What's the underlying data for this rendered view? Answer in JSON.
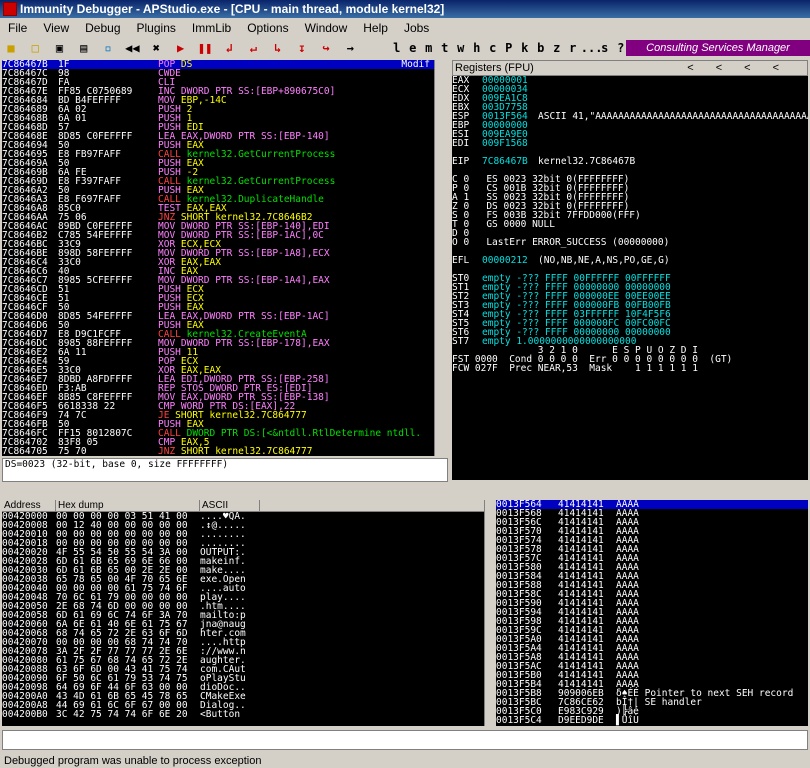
{
  "window": {
    "title": "Immunity Debugger - APStudio.exe - [CPU - main thread, module kernel32]"
  },
  "menu": [
    "File",
    "View",
    "Debug",
    "Plugins",
    "ImmLib",
    "Options",
    "Window",
    "Help",
    "Jobs"
  ],
  "toolbar": {
    "icons": [
      "open-icon",
      "folder-icon",
      "restart-icon",
      "close-icon",
      "attach-icon"
    ],
    "run_icons": [
      "rewind",
      "stop",
      "play",
      "pause",
      "step-into",
      "step-over",
      "trace-into",
      "trace-over",
      "return",
      "goto"
    ],
    "letters": [
      "l",
      "e",
      "m",
      "t",
      "w",
      "h",
      "c",
      "P",
      "k",
      "b",
      "z",
      "r",
      "...",
      "s",
      "?"
    ],
    "consulting": "Consulting Services Manager"
  },
  "cpu": {
    "rows": [
      {
        "addr": "7C86467B",
        "hex": "1F",
        "asm": "POP DS",
        "cls": "",
        "sel": true,
        "comment": "Modif"
      },
      {
        "addr": "7C86467C",
        "hex": "98",
        "asm": "CWDE",
        "cls": ""
      },
      {
        "addr": "7C86467D",
        "hex": "FA",
        "asm": "CLI",
        "cls": ""
      },
      {
        "addr": "7C86467E",
        "hex": "FF85 C0750689",
        "asm": "INC DWORD PTR SS:[EBP+890675C0]",
        "cls": ""
      },
      {
        "addr": "7C864684",
        "hex": "BD B4FEFFFF",
        "asm": "MOV EBP,-14C",
        "cls": ""
      },
      {
        "addr": "7C864689",
        "hex": "6A 02",
        "asm": "PUSH 2",
        "cls": ""
      },
      {
        "addr": "7C86468B",
        "hex": "6A 01",
        "asm": "PUSH 1",
        "cls": ""
      },
      {
        "addr": "7C86468D",
        "hex": "57",
        "asm": "PUSH EDI",
        "cls": ""
      },
      {
        "addr": "7C86468E",
        "hex": "8D85 C0FEFFFF",
        "asm": "LEA EAX,DWORD PTR SS:[EBP-140]",
        "cls": ""
      },
      {
        "addr": "7C864694",
        "hex": "50",
        "asm": "PUSH EAX",
        "cls": ""
      },
      {
        "addr": "7C864695",
        "hex": "E8 FB97FAFF",
        "asm": "CALL kernel32.GetCurrentProcess",
        "cls": "call"
      },
      {
        "addr": "7C86469A",
        "hex": "50",
        "asm": "PUSH EAX",
        "cls": ""
      },
      {
        "addr": "7C86469B",
        "hex": "6A FE",
        "asm": "PUSH -2",
        "cls": ""
      },
      {
        "addr": "7C86469D",
        "hex": "E8 F397FAFF",
        "asm": "CALL kernel32.GetCurrentProcess",
        "cls": "call"
      },
      {
        "addr": "7C8646A2",
        "hex": "50",
        "asm": "PUSH EAX",
        "cls": ""
      },
      {
        "addr": "7C8646A3",
        "hex": "E8 F697FAFF",
        "asm": "CALL kernel32.DuplicateHandle",
        "cls": "call"
      },
      {
        "addr": "7C8646A8",
        "hex": "85C0",
        "asm": "TEST EAX,EAX",
        "cls": ""
      },
      {
        "addr": "7C8646AA",
        "hex": "75 06",
        "asm": "JNZ SHORT kernel32.7C8646B2",
        "cls": "jmp"
      },
      {
        "addr": "7C8646AC",
        "hex": "89BD C0FEFFFF",
        "asm": "MOV DWORD PTR SS:[EBP-140],EDI",
        "cls": ""
      },
      {
        "addr": "7C8646B2",
        "hex": "C785 54FEFFFF",
        "asm": "MOV DWORD PTR SS:[EBP-1AC],0C",
        "cls": ""
      },
      {
        "addr": "7C8646BC",
        "hex": "33C9",
        "asm": "XOR ECX,ECX",
        "cls": ""
      },
      {
        "addr": "7C8646BE",
        "hex": "898D 58FEFFFF",
        "asm": "MOV DWORD PTR SS:[EBP-1A8],ECX",
        "cls": ""
      },
      {
        "addr": "7C8646C4",
        "hex": "33C0",
        "asm": "XOR EAX,EAX",
        "cls": ""
      },
      {
        "addr": "7C8646C6",
        "hex": "40",
        "asm": "INC EAX",
        "cls": ""
      },
      {
        "addr": "7C8646C7",
        "hex": "8985 5CFEFFFF",
        "asm": "MOV DWORD PTR SS:[EBP-1A4],EAX",
        "cls": ""
      },
      {
        "addr": "7C8646CD",
        "hex": "51",
        "asm": "PUSH ECX",
        "cls": ""
      },
      {
        "addr": "7C8646CE",
        "hex": "51",
        "asm": "PUSH ECX",
        "cls": ""
      },
      {
        "addr": "7C8646CF",
        "hex": "50",
        "asm": "PUSH EAX",
        "cls": ""
      },
      {
        "addr": "7C8646D0",
        "hex": "8D85 54FEFFFF",
        "asm": "LEA EAX,DWORD PTR SS:[EBP-1AC]",
        "cls": ""
      },
      {
        "addr": "7C8646D6",
        "hex": "50",
        "asm": "PUSH EAX",
        "cls": ""
      },
      {
        "addr": "7C8646D7",
        "hex": "E8 D9C1FCFF",
        "asm": "CALL kernel32.CreateEventA",
        "cls": "call"
      },
      {
        "addr": "7C8646DC",
        "hex": "8985 88FEFFFF",
        "asm": "MOV DWORD PTR SS:[EBP-178],EAX",
        "cls": ""
      },
      {
        "addr": "7C8646E2",
        "hex": "6A 11",
        "asm": "PUSH 11",
        "cls": ""
      },
      {
        "addr": "7C8646E4",
        "hex": "59",
        "asm": "POP ECX",
        "cls": ""
      },
      {
        "addr": "7C8646E5",
        "hex": "33C0",
        "asm": "XOR EAX,EAX",
        "cls": ""
      },
      {
        "addr": "7C8646E7",
        "hex": "8DBD A8FDFFFF",
        "asm": "LEA EDI,DWORD PTR SS:[EBP-258]",
        "cls": ""
      },
      {
        "addr": "7C8646ED",
        "hex": "F3:AB",
        "asm": "REP STOS DWORD PTR ES:[EDI]",
        "cls": ""
      },
      {
        "addr": "7C8646EF",
        "hex": "8B85 C8FEFFFF",
        "asm": "MOV EAX,DWORD PTR SS:[EBP-138]",
        "cls": ""
      },
      {
        "addr": "7C8646F5",
        "hex": "6618338 22",
        "asm": "CMP WORD PTR DS:[EAX],22",
        "cls": ""
      },
      {
        "addr": "7C8646F9",
        "hex": "74 7C",
        "asm": "JE SHORT kernel32.7C864777",
        "cls": "jmp"
      },
      {
        "addr": "7C8646FB",
        "hex": "50",
        "asm": "PUSH EAX",
        "cls": ""
      },
      {
        "addr": "7C8646FC",
        "hex": "FF15 8012807C",
        "asm": "CALL DWORD PTR DS:[<&ntdll.RtlDetermine ntdll.",
        "cls": "call"
      },
      {
        "addr": "7C864702",
        "hex": "83F8 05",
        "asm": "CMP EAX,5",
        "cls": ""
      },
      {
        "addr": "7C864705",
        "hex": "75 70",
        "asm": "JNZ SHORT kernel32.7C864777",
        "cls": "jmp"
      }
    ],
    "info": "DS=0023 (32-bit, base 0, size FFFFFFFF)"
  },
  "registers": {
    "header": "Registers (FPU)",
    "nav": [
      "<",
      "<",
      "<",
      "<"
    ],
    "gp": [
      {
        "name": "EAX",
        "value": "00000001",
        "comment": ""
      },
      {
        "name": "ECX",
        "value": "00000034",
        "comment": ""
      },
      {
        "name": "EDX",
        "value": "009EA1C8",
        "comment": ""
      },
      {
        "name": "EBX",
        "value": "003D7758",
        "comment": ""
      },
      {
        "name": "ESP",
        "value": "0013F564",
        "comment": "ASCII 41,\"AAAAAAAAAAAAAAAAAAAAAAAAAAAAAAAAAAAAAA"
      },
      {
        "name": "EBP",
        "value": "00000000",
        "comment": ""
      },
      {
        "name": "ESI",
        "value": "009EA9E0",
        "comment": ""
      },
      {
        "name": "EDI",
        "value": "009F1568",
        "comment": ""
      }
    ],
    "eip": {
      "name": "EIP",
      "value": "7C86467B",
      "comment": "kernel32.7C86467B"
    },
    "flags": [
      "C 0   ES 0023 32bit 0(FFFFFFFF)",
      "P 0   CS 001B 32bit 0(FFFFFFFF)",
      "A 1   SS 0023 32bit 0(FFFFFFFF)",
      "Z 0   DS 0023 32bit 0(FFFFFFFF)",
      "S 0   FS 003B 32bit 7FFDD000(FFF)",
      "T 0   GS 0000 NULL",
      "D 0",
      "O 0   LastErr ERROR_SUCCESS (00000000)"
    ],
    "efl": {
      "name": "EFL",
      "value": "00000212",
      "comment": "(NO,NB,NE,A,NS,PO,GE,G)"
    },
    "fpu": [
      {
        "name": "ST0",
        "text": "empty -??? FFFF 00FFFFFF 00FFFFFF"
      },
      {
        "name": "ST1",
        "text": "empty -??? FFFF 00000000 00000000"
      },
      {
        "name": "ST2",
        "text": "empty -??? FFFF 000000EE 00EE00EE"
      },
      {
        "name": "ST3",
        "text": "empty -??? FFFF 000000FB 00FB00FB"
      },
      {
        "name": "ST4",
        "text": "empty -??? FFFF 03FFFFFF 10F4F5F6"
      },
      {
        "name": "ST5",
        "text": "empty -??? FFFF 000000FC 00FC00FC"
      },
      {
        "name": "ST6",
        "text": "empty -??? FFFF 00000000 00000000"
      },
      {
        "name": "ST7",
        "text": "empty 1.0000000000000000000"
      }
    ],
    "bits_header": "               3 2 1 0      E S P U O Z D I",
    "fst": "FST 0000  Cond 0 0 0 0  Err 0 0 0 0 0 0 0 0  (GT)",
    "fcw": "FCW 027F  Prec NEAR,53  Mask    1 1 1 1 1 1"
  },
  "dump": {
    "headers": [
      "Address",
      "Hex dump",
      "ASCII"
    ],
    "rows": [
      {
        "addr": "00420000",
        "hex": "00 00 00 00 03 51 41 00",
        "ascii": "....♥QA."
      },
      {
        "addr": "00420008",
        "hex": "00 12 40 00 00 00 00 00",
        "ascii": ".↕@....."
      },
      {
        "addr": "00420010",
        "hex": "00 00 00 00 00 00 00 00",
        "ascii": "........"
      },
      {
        "addr": "00420018",
        "hex": "00 00 00 00 00 00 00 00",
        "ascii": "........"
      },
      {
        "addr": "00420020",
        "hex": "4F 55 54 50 55 54 3A 00",
        "ascii": "OUTPUT:."
      },
      {
        "addr": "00420028",
        "hex": "6D 61 6B 65 69 6E 66 00",
        "ascii": "makeinf."
      },
      {
        "addr": "00420030",
        "hex": "6D 61 6B 65 00 2E 2E 00",
        "ascii": "make...."
      },
      {
        "addr": "00420038",
        "hex": "65 78 65 00 4F 70 65 6E",
        "ascii": "exe.Open"
      },
      {
        "addr": "00420040",
        "hex": "00 00 00 00 61 75 74 6F",
        "ascii": "....auto"
      },
      {
        "addr": "00420048",
        "hex": "70 6C 61 79 00 00 00 00",
        "ascii": "play...."
      },
      {
        "addr": "00420050",
        "hex": "2E 68 74 6D 00 00 00 00",
        "ascii": ".htm...."
      },
      {
        "addr": "00420058",
        "hex": "6D 61 69 6C 74 6F 3A 70",
        "ascii": "mailto:p"
      },
      {
        "addr": "00420060",
        "hex": "6A 6E 61 40 6E 61 75 67",
        "ascii": "jna@naug"
      },
      {
        "addr": "00420068",
        "hex": "68 74 65 72 2E 63 6F 6D",
        "ascii": "hter.com"
      },
      {
        "addr": "00420070",
        "hex": "00 00 00 00 68 74 74 70",
        "ascii": "....http"
      },
      {
        "addr": "00420078",
        "hex": "3A 2F 2F 77 77 77 2E 6E",
        "ascii": "://www.n"
      },
      {
        "addr": "00420080",
        "hex": "61 75 67 68 74 65 72 2E",
        "ascii": "aughter."
      },
      {
        "addr": "00420088",
        "hex": "63 6F 6D 00 43 41 75 74",
        "ascii": "com.CAut"
      },
      {
        "addr": "00420090",
        "hex": "6F 50 6C 61 79 53 74 75",
        "ascii": "oPlayStu"
      },
      {
        "addr": "00420098",
        "hex": "64 69 6F 44 6F 63 00 00",
        "ascii": "dioDoc.."
      },
      {
        "addr": "004200A0",
        "hex": "43 4D 61 6B 65 45 78 65",
        "ascii": "CMakeExe"
      },
      {
        "addr": "004200A8",
        "hex": "44 69 61 6C 6F 67 00 00",
        "ascii": "Dialog.."
      },
      {
        "addr": "004200B0",
        "hex": "3C 42 75 74 74 6F 6E 20",
        "ascii": "<Button "
      }
    ]
  },
  "stack": {
    "rows": [
      {
        "addr": "0013F564",
        "val": "41414141",
        "comment": "AAAA",
        "sel": true
      },
      {
        "addr": "0013F568",
        "val": "41414141",
        "comment": "AAAA"
      },
      {
        "addr": "0013F56C",
        "val": "41414141",
        "comment": "AAAA"
      },
      {
        "addr": "0013F570",
        "val": "41414141",
        "comment": "AAAA"
      },
      {
        "addr": "0013F574",
        "val": "41414141",
        "comment": "AAAA"
      },
      {
        "addr": "0013F578",
        "val": "41414141",
        "comment": "AAAA"
      },
      {
        "addr": "0013F57C",
        "val": "41414141",
        "comment": "AAAA"
      },
      {
        "addr": "0013F580",
        "val": "41414141",
        "comment": "AAAA"
      },
      {
        "addr": "0013F584",
        "val": "41414141",
        "comment": "AAAA"
      },
      {
        "addr": "0013F588",
        "val": "41414141",
        "comment": "AAAA"
      },
      {
        "addr": "0013F58C",
        "val": "41414141",
        "comment": "AAAA"
      },
      {
        "addr": "0013F590",
        "val": "41414141",
        "comment": "AAAA"
      },
      {
        "addr": "0013F594",
        "val": "41414141",
        "comment": "AAAA"
      },
      {
        "addr": "0013F598",
        "val": "41414141",
        "comment": "AAAA"
      },
      {
        "addr": "0013F59C",
        "val": "41414141",
        "comment": "AAAA"
      },
      {
        "addr": "0013F5A0",
        "val": "41414141",
        "comment": "AAAA"
      },
      {
        "addr": "0013F5A4",
        "val": "41414141",
        "comment": "AAAA"
      },
      {
        "addr": "0013F5A8",
        "val": "41414141",
        "comment": "AAAA"
      },
      {
        "addr": "0013F5AC",
        "val": "41414141",
        "comment": "AAAA"
      },
      {
        "addr": "0013F5B0",
        "val": "41414141",
        "comment": "AAAA"
      },
      {
        "addr": "0013F5B4",
        "val": "41414141",
        "comment": "AAAA"
      },
      {
        "addr": "0013F5B8",
        "val": "909006EB",
        "comment": "δ♠ÉÉ Pointer to next SEH record"
      },
      {
        "addr": "0013F5BC",
        "val": "7C86CE62",
        "comment": "bÎ†| SE handler"
      },
      {
        "addr": "0013F5C0",
        "val": "E983C929",
        "comment": ")╠âé"
      },
      {
        "addr": "0013F5C4",
        "val": "D9EED9DE",
        "comment": "▌ÙîÙ"
      }
    ]
  },
  "status": "Debugged program was unable to process exception"
}
